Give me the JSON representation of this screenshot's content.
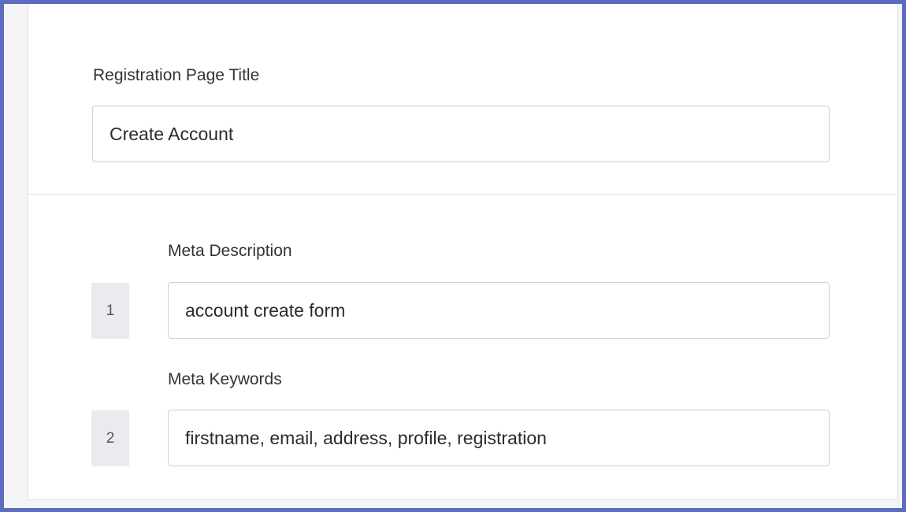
{
  "form": {
    "title_field": {
      "label": "Registration Page Title",
      "value": "Create Account"
    },
    "meta_fields": [
      {
        "number": "1",
        "label": "Meta Description",
        "value": "account create form"
      },
      {
        "number": "2",
        "label": "Meta Keywords",
        "value": "firstname, email, address, profile, registration"
      }
    ]
  }
}
